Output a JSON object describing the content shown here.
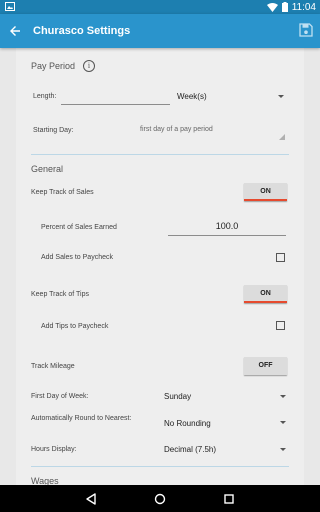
{
  "status": {
    "time": "11:04"
  },
  "appbar": {
    "title": "Churasco Settings",
    "back_icon": "arrow-back-icon",
    "save_icon": "save-icon"
  },
  "pay_period": {
    "heading": "Pay Period",
    "length_label": "Length:",
    "length_value": "",
    "length_unit": "Week(s)",
    "starting_day_label": "Starting Day:",
    "starting_day_placeholder": "first day of a pay period"
  },
  "general": {
    "heading": "General",
    "track_sales_label": "Keep Track of Sales",
    "track_sales_toggle": "ON",
    "percent_sales_label": "Percent of Sales Earned",
    "percent_sales_value": "100.0",
    "add_sales_label": "Add Sales to Paycheck",
    "add_sales_checked": false,
    "track_tips_label": "Keep Track of Tips",
    "track_tips_toggle": "ON",
    "add_tips_label": "Add Tips to Paycheck",
    "add_tips_checked": false,
    "track_mileage_label": "Track Mileage",
    "track_mileage_toggle": "OFF",
    "first_day_label": "First Day of Week:",
    "first_day_value": "Sunday",
    "round_label": "Automatically Round to Nearest:",
    "round_value": "No Rounding",
    "hours_display_label": "Hours Display:",
    "hours_display_value": "Decimal (7.5h)"
  },
  "wages": {
    "heading": "Wages"
  },
  "colors": {
    "statusbar": "#1d7fb0",
    "appbar": "#2a94cc",
    "toggle_on_accent": "#e64a2e"
  }
}
